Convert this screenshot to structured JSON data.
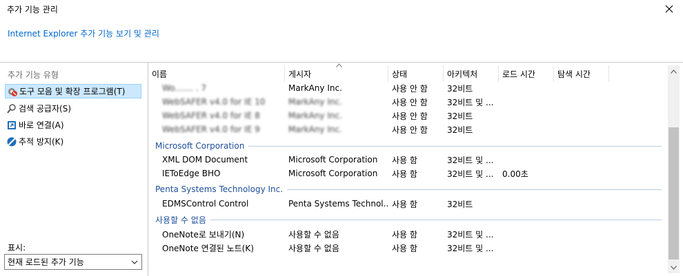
{
  "window": {
    "title": "추가 기능 관리"
  },
  "header": {
    "link_text": "Internet Explorer 추가 기능 보기 및 관리"
  },
  "sidebar": {
    "title": "추가 기능 유형",
    "items": [
      {
        "label": "도구 모음 및 확장 프로그램(T)",
        "icon": "gear-icon"
      },
      {
        "label": "검색 공급자(S)",
        "icon": "search-icon"
      },
      {
        "label": "바로 연결(A)",
        "icon": "accelerator-icon"
      },
      {
        "label": "추적 방지(K)",
        "icon": "tracking-protection-icon"
      }
    ],
    "show_label": "표시:",
    "show_selected": "현재 로드된 추가 기능"
  },
  "columns": [
    "이름",
    "게시자",
    "상태",
    "아키텍처",
    "로드 시간",
    "탐색 시간"
  ],
  "rows": [
    {
      "name": "Wo.......   . 7",
      "publisher": "MarkAny Inc.",
      "status": "사용 안 함",
      "arch": "32비트",
      "load": "",
      "nav": ""
    },
    {
      "name": "WebSAFER v4.0 for IE 10",
      "publisher": "MarkAny Inc.",
      "status": "사용 안 함",
      "arch": "32비트 및 ...",
      "load": "",
      "nav": ""
    },
    {
      "name": "WebSAFER v4.0 for IE 8",
      "publisher": "MarkAny Inc.",
      "status": "사용 안 함",
      "arch": "32비트",
      "load": "",
      "nav": ""
    },
    {
      "name": "WebSAFER v4.0 for IE 9",
      "publisher": "MarkAny Inc.",
      "status": "사용 안 함",
      "arch": "32비트",
      "load": "",
      "nav": ""
    }
  ],
  "groups": [
    {
      "label": "Microsoft Corporation",
      "rows": [
        {
          "name": "XML DOM Document",
          "publisher": "Microsoft Corporation",
          "status": "사용 함",
          "arch": "32비트 및 ...",
          "load": "",
          "nav": ""
        },
        {
          "name": "IEToEdge BHO",
          "publisher": "Microsoft Corporation",
          "status": "사용 함",
          "arch": "32비트 및 ...",
          "load": "0.00초",
          "nav": ""
        }
      ]
    },
    {
      "label": "Penta Systems Technology Inc.",
      "rows": [
        {
          "name": "EDMSControl Control",
          "publisher": "Penta Systems Technol...",
          "status": "사용 함",
          "arch": "32비트",
          "load": "",
          "nav": ""
        }
      ]
    },
    {
      "label": "사용할 수 없음",
      "rows": [
        {
          "name": "OneNote로 보내기(N)",
          "publisher": "사용할 수 없음",
          "status": "사용 함",
          "arch": "32비트 및 ...",
          "load": "",
          "nav": ""
        },
        {
          "name": "OneNote 연결된 노트(K)",
          "publisher": "사용할 수 없음",
          "status": "사용 함",
          "arch": "32비트 및 ...",
          "load": "",
          "nav": ""
        }
      ]
    }
  ],
  "colors": {
    "link": "#0066cc",
    "group": "#1e4e99",
    "selection": "#cce8ff"
  }
}
